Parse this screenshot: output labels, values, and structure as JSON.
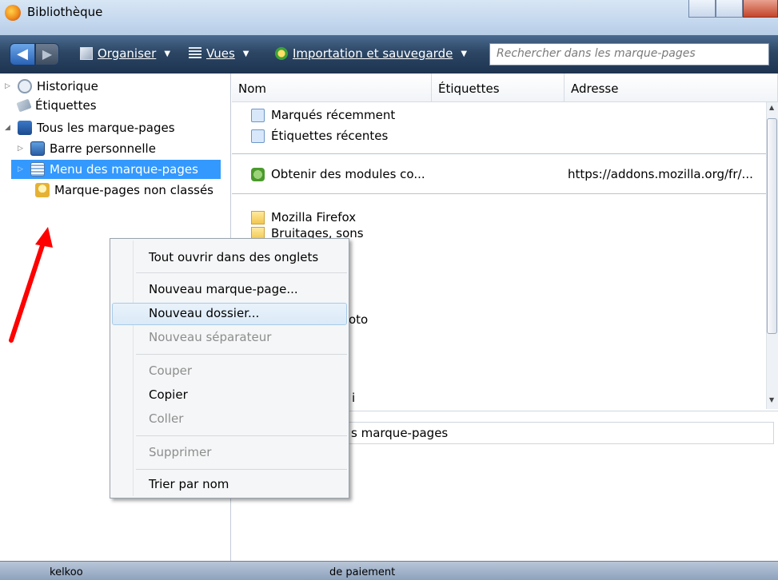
{
  "window": {
    "title": "Bibliothèque"
  },
  "toolbar": {
    "organize": "Organiser",
    "views": "Vues",
    "import": "Importation et sauvegarde",
    "search_placeholder": "Rechercher dans les marque-pages"
  },
  "tree": {
    "items": [
      {
        "label": "Historique"
      },
      {
        "label": "Étiquettes"
      },
      {
        "label": "Tous les marque-pages"
      },
      {
        "label": "Barre personnelle"
      },
      {
        "label": "Menu des marque-pages"
      },
      {
        "label": "Marque-pages non classés"
      }
    ]
  },
  "columns": {
    "name": "Nom",
    "tags": "Étiquettes",
    "address": "Adresse"
  },
  "rows": [
    {
      "name": "Marqués récemment",
      "address": ""
    },
    {
      "name": "Étiquettes récentes",
      "address": ""
    },
    {
      "name": "Obtenir des modules co...",
      "address": "https://addons.mozilla.org/fr/..."
    },
    {
      "name": "Mozilla Firefox",
      "address": ""
    },
    {
      "name": "Bruitages, sons",
      "address": ""
    },
    {
      "name": "oto",
      "address": ""
    },
    {
      "name": "i",
      "address": ""
    }
  ],
  "details": {
    "location_value": "s marque-pages"
  },
  "taskbar": {
    "item1": "kelkoo",
    "item2": "de paiement"
  },
  "context_menu": {
    "open_all": "Tout ouvrir dans des onglets",
    "new_bookmark": "Nouveau marque-page...",
    "new_folder": "Nouveau dossier...",
    "new_separator": "Nouveau séparateur",
    "cut": "Couper",
    "copy": "Copier",
    "paste": "Coller",
    "delete": "Supprimer",
    "sort": "Trier par nom"
  },
  "colors": {
    "selection": "#3399ff",
    "arrow": "#ff0000"
  }
}
